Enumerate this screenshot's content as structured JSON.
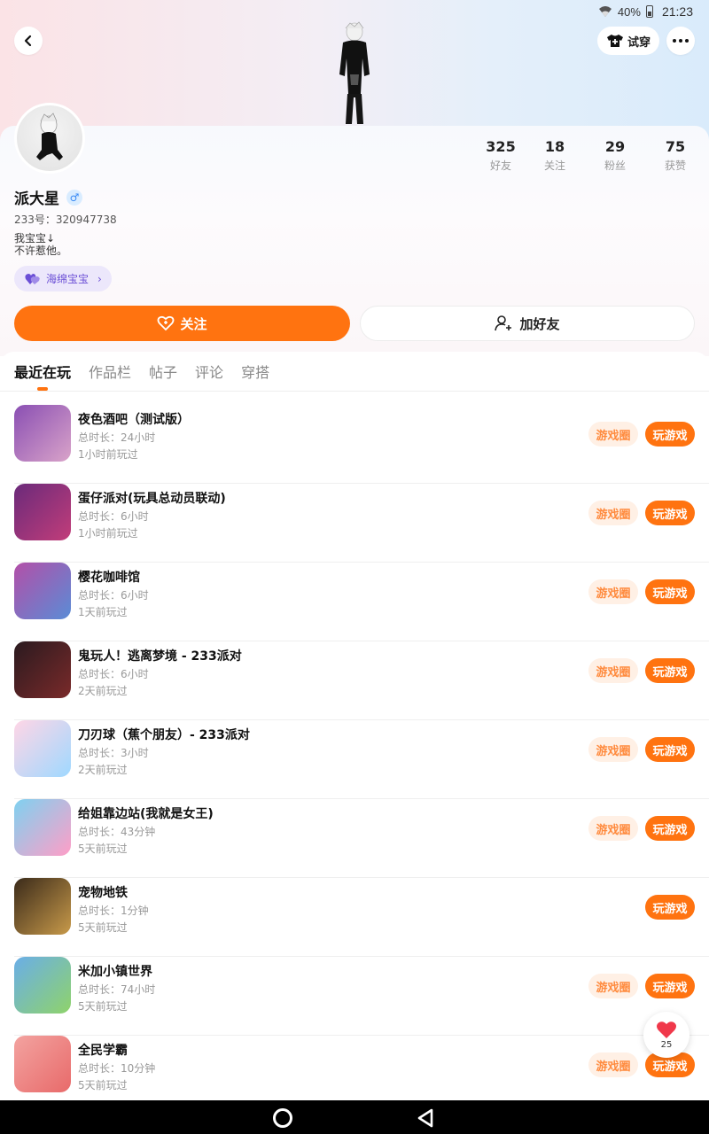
{
  "status_bar": {
    "battery": "40%",
    "time": "21:23"
  },
  "header": {
    "tryon_label": "试穿"
  },
  "profile": {
    "username": "派大星",
    "gender_symbol": "♂",
    "uid": "233号：320947738",
    "bio_line1": "我宝宝↓",
    "bio_line2": "不许惹他。",
    "badge": "海绵宝宝",
    "stats": [
      {
        "num": "325",
        "label": "好友"
      },
      {
        "num": "18",
        "label": "关注"
      },
      {
        "num": "29",
        "label": "粉丝"
      },
      {
        "num": "75",
        "label": "获赞"
      }
    ],
    "follow_label": "关注",
    "add_friend_label": "加好友"
  },
  "tabs": [
    {
      "label": "最近在玩",
      "active": true
    },
    {
      "label": "作品栏"
    },
    {
      "label": "帖子"
    },
    {
      "label": "评论"
    },
    {
      "label": "穿搭"
    }
  ],
  "circle_label": "游戏圈",
  "play_label": "玩游戏",
  "games": [
    {
      "name": "夜色酒吧（测试版）",
      "duration": "总时长：24小时",
      "last_played": "1小时前玩过",
      "has_circle": true,
      "icon_colors": [
        "#8a4fb3",
        "#d9a3c9"
      ]
    },
    {
      "name": "蛋仔派对(玩具总动员联动)",
      "duration": "总时长：6小时",
      "last_played": "1小时前玩过",
      "has_circle": true,
      "icon_colors": [
        "#6a2a7a",
        "#c23d7a"
      ]
    },
    {
      "name": "樱花咖啡馆",
      "duration": "总时长：6小时",
      "last_played": "1天前玩过",
      "has_circle": true,
      "icon_colors": [
        "#b34fa8",
        "#5a8cd6"
      ]
    },
    {
      "name": "鬼玩人！逃离梦境 - 233派对",
      "duration": "总时长：6小时",
      "last_played": "2天前玩过",
      "has_circle": true,
      "icon_colors": [
        "#2a1a1f",
        "#7a2a2a"
      ]
    },
    {
      "name": "刀刃球（蕉个朋友）- 233派对",
      "duration": "总时长：3小时",
      "last_played": "2天前玩过",
      "has_circle": true,
      "icon_colors": [
        "#ffd6e6",
        "#9fd8ff"
      ]
    },
    {
      "name": "给姐靠边站(我就是女王)",
      "duration": "总时长：43分钟",
      "last_played": "5天前玩过",
      "has_circle": true,
      "icon_colors": [
        "#7fd1f0",
        "#ff9ec7"
      ]
    },
    {
      "name": "宠物地铁",
      "duration": "总时长：1分钟",
      "last_played": "5天前玩过",
      "has_circle": false,
      "icon_colors": [
        "#3a2a1a",
        "#c89a4a"
      ]
    },
    {
      "name": "米加小镇世界",
      "duration": "总时长：74小时",
      "last_played": "5天前玩过",
      "has_circle": true,
      "icon_colors": [
        "#6aaee8",
        "#8fd36a"
      ]
    },
    {
      "name": "全民学霸",
      "duration": "总时长：10分钟",
      "last_played": "5天前玩过",
      "has_circle": true,
      "icon_colors": [
        "#f3a3a0",
        "#e86a6a"
      ]
    }
  ],
  "like_fab": {
    "count": "25"
  }
}
